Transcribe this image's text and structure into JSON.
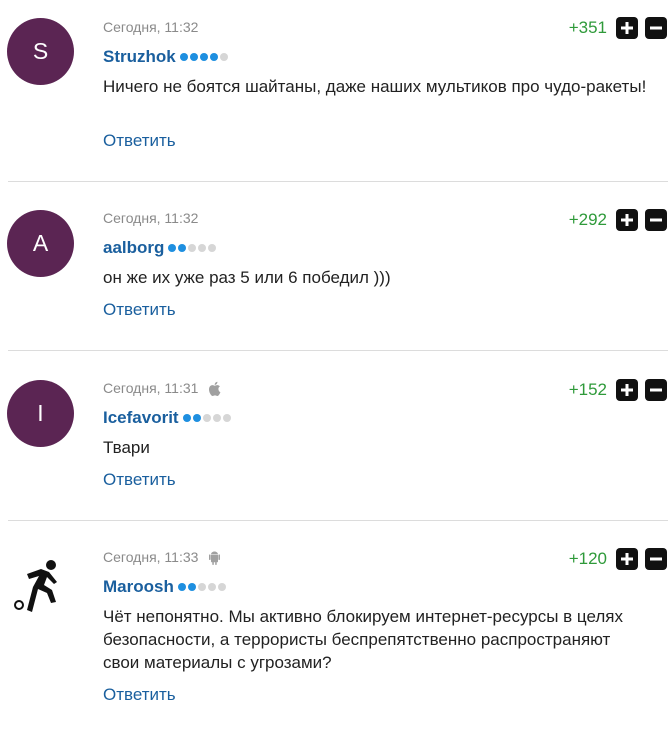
{
  "reply_label": "Ответить",
  "comments": [
    {
      "avatar_letter": "S",
      "timestamp": "Сегодня, 11:32",
      "device": "",
      "author": "Struzhok",
      "rating_dots": 4,
      "text": "Ничего не боятся шайтаны, даже наших мультиков про чудо-ракеты!",
      "score": "+351"
    },
    {
      "avatar_letter": "A",
      "timestamp": "Сегодня, 11:32",
      "device": "",
      "author": "aalborg",
      "rating_dots": 2,
      "text": "он же их уже раз 5 или 6 победил )))",
      "score": "+292"
    },
    {
      "avatar_letter": "I",
      "timestamp": "Сегодня, 11:31",
      "device": "apple-icon",
      "author": "Icefavorit",
      "rating_dots": 2,
      "text": "Твари",
      "score": "+152"
    },
    {
      "avatar_letter": "",
      "avatar_icon": "soccer-player-icon",
      "timestamp": "Сегодня, 11:33",
      "device": "android-icon",
      "author": "Maroosh",
      "rating_dots": 2,
      "text": "Чёт непонятно. Мы активно блокируем интернет-ресурсы в целях безопасности, а террористы беспрепятственно распространяют свои материалы с угрозами?",
      "score": "+120"
    }
  ],
  "colors": {
    "avatar_bg": "#5b2553",
    "author": "#1a5f9e",
    "score": "#2f9a3a",
    "dot_active": "#1e8fe0",
    "dot_inactive": "#d6d6d6"
  }
}
